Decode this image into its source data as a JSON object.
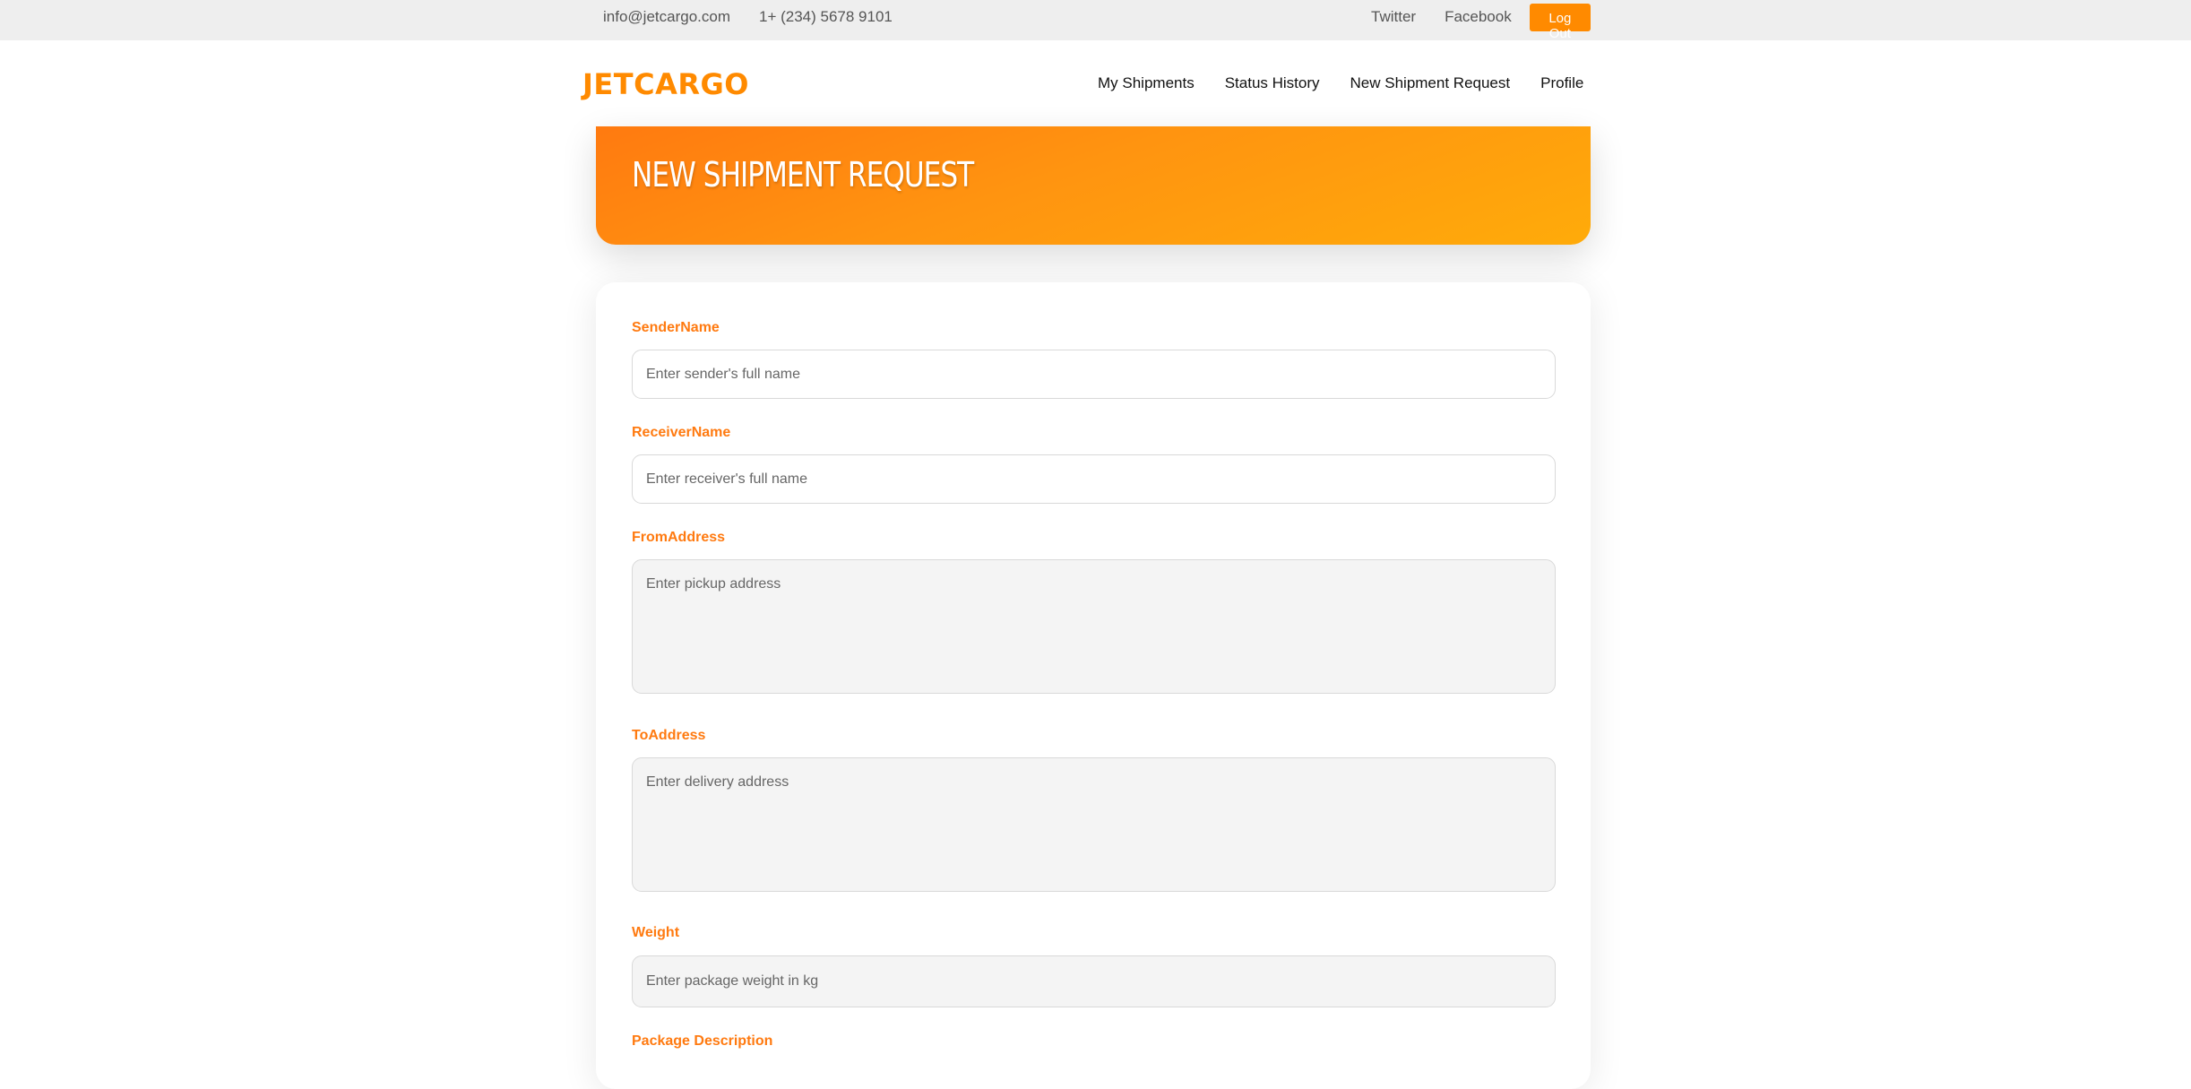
{
  "topbar": {
    "email": "info@jetcargo.com",
    "phone": "1+ (234) 5678 9101",
    "links": [
      "Twitter",
      "Facebook"
    ],
    "logout_label": "Log Out",
    "accent_color": "#ff8a00"
  },
  "nav": {
    "logo": "JETCARGO",
    "items": [
      "My Shipments",
      "Status History",
      "New Shipment Request",
      "Profile"
    ]
  },
  "hero": {
    "title": "NEW SHIPMENT REQUEST"
  },
  "form": {
    "fields": [
      {
        "label": "SenderName",
        "placeholder": "Enter sender's full name",
        "value": ""
      },
      {
        "label": "ReceiverName",
        "placeholder": "Enter receiver's full name",
        "value": ""
      },
      {
        "label": "FromAddress",
        "placeholder": "Enter pickup address",
        "value": ""
      },
      {
        "label": "ToAddress",
        "placeholder": "Enter delivery address",
        "value": ""
      },
      {
        "label": "Weight",
        "placeholder": "Enter package weight in kg",
        "value": ""
      },
      {
        "label": "Package Description",
        "placeholder": "",
        "value": ""
      }
    ]
  }
}
